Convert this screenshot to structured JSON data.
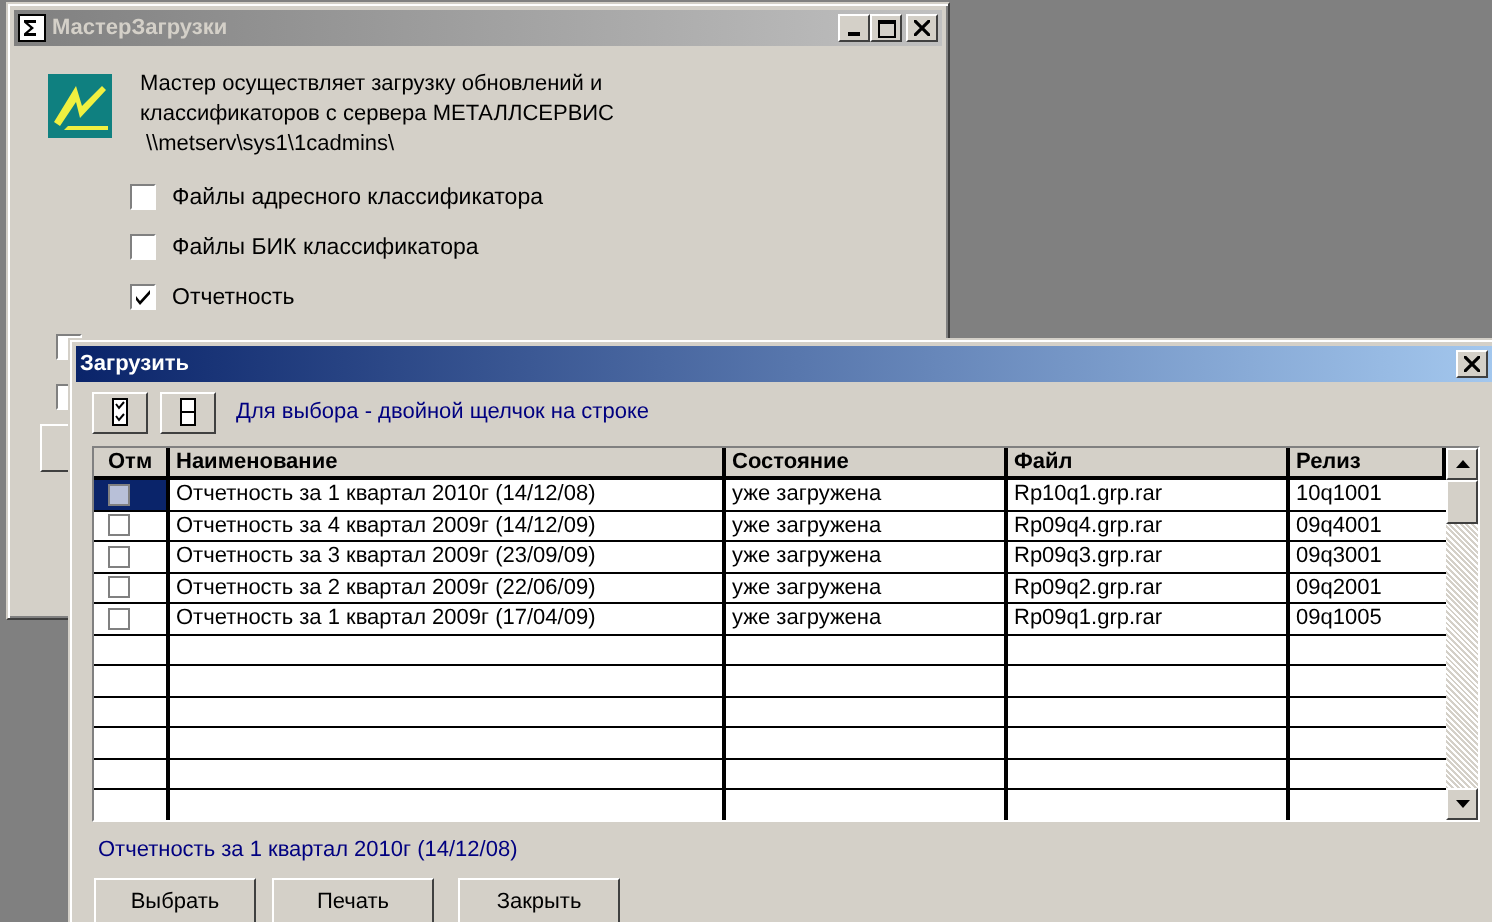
{
  "main_window": {
    "title": "МастерЗагрузки",
    "description": [
      "Мастер осуществляет загрузку  обновлений и",
      "классификаторов с сервера МЕТАЛЛСЕРВИС",
      "\\\\metserv\\sys1\\1cadmins\\"
    ],
    "options": [
      {
        "label": "Файлы адресного классификатора",
        "checked": false
      },
      {
        "label": "Файлы БИК классификатора",
        "checked": false
      },
      {
        "label": "Отчетность",
        "checked": true
      }
    ],
    "covered_options": [
      {
        "checked": false
      },
      {
        "checked": false
      }
    ]
  },
  "dialog": {
    "title": "Загрузить",
    "hint": "Для выбора - двойной щелчок на строке",
    "columns": [
      "Отм",
      "Наименование",
      "Состояние",
      "Файл",
      "Релиз"
    ],
    "rows": [
      {
        "checked": false,
        "selected": true,
        "name": "Отчетность за 1 квартал 2010г (14/12/08)",
        "state": "уже загружена",
        "file": "Rp10q1.grp.rar",
        "release": "10q1001"
      },
      {
        "checked": false,
        "selected": false,
        "name": "Отчетность за 4 квартал 2009г (14/12/09)",
        "state": "уже загружена",
        "file": "Rp09q4.grp.rar",
        "release": "09q4001"
      },
      {
        "checked": false,
        "selected": false,
        "name": "Отчетность за 3 квартал 2009г (23/09/09)",
        "state": "уже загружена",
        "file": "Rp09q3.grp.rar",
        "release": "09q3001"
      },
      {
        "checked": false,
        "selected": false,
        "name": "Отчетность за 2 квартал 2009г (22/06/09)",
        "state": "уже загружена",
        "file": "Rp09q2.grp.rar",
        "release": "09q2001"
      },
      {
        "checked": false,
        "selected": false,
        "name": "Отчетность за 1 квартал 2009г (17/04/09)",
        "state": "уже загружена",
        "file": "Rp09q1.grp.rar",
        "release": "09q1005"
      }
    ],
    "status": "Отчетность за 1 квартал 2010г (14/12/08)",
    "buttons": [
      "Выбрать",
      "Печать",
      "Закрыть"
    ]
  }
}
